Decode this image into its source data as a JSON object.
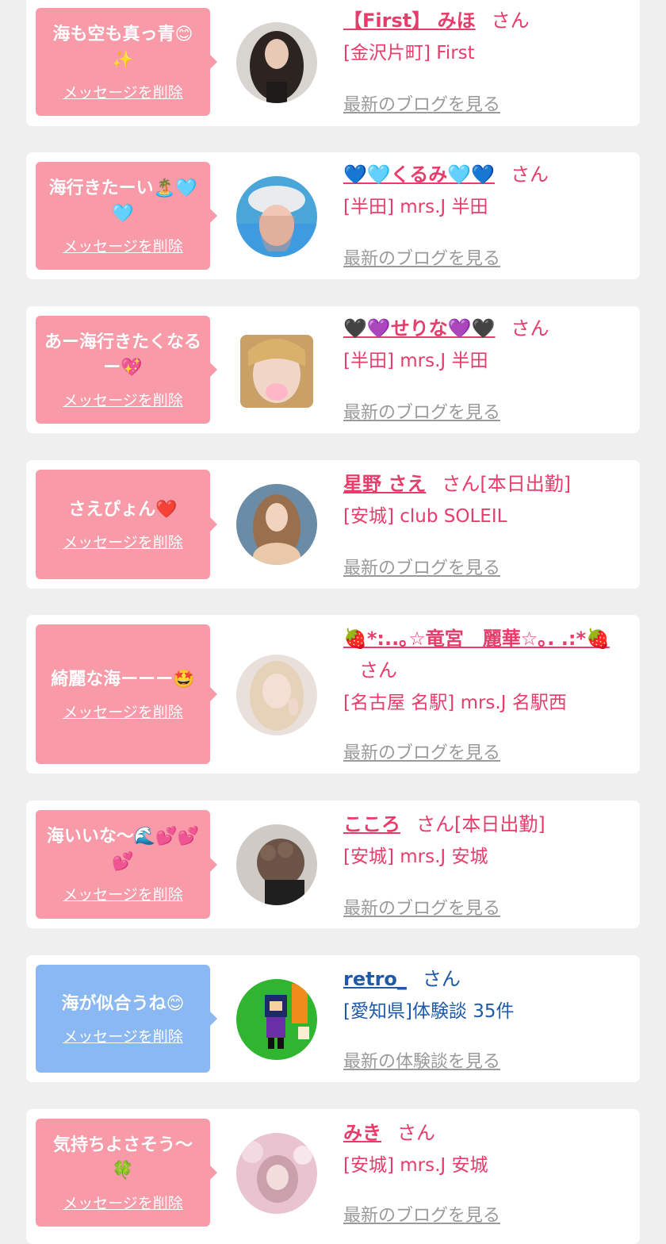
{
  "accent_pink": "#e83c6a",
  "accent_blue": "#1f5aa6",
  "bubble_pink": "#f89aa8",
  "bubble_blue": "#8ab8f3",
  "delete_label": "メッセージを削除",
  "items": [
    {
      "message": "海も空も真っ青😊✨",
      "name": "【First】 みほ",
      "san": "さん",
      "shop": "[金沢片町] First",
      "blog": "最新のブログを見る",
      "type": "pink",
      "avatar_icon": "woman-curly-hair-photo"
    },
    {
      "message": "海行きたーい🏝️🩵🩵",
      "name": "💙🩵くるみ🩵💙",
      "san": "さん",
      "shop": "[半田] mrs.J 半田",
      "blog": "最新のブログを見る",
      "type": "pink",
      "avatar_icon": "woman-cap-photo"
    },
    {
      "message": "あー海行きたくなるー💖",
      "name": "🖤💜せりな💜🖤",
      "san": "さん",
      "shop": "[半田] mrs.J 半田",
      "blog": "最新のブログを見る",
      "type": "pink",
      "avatar_icon": "woman-blonde-photo"
    },
    {
      "message": "さえぴょん❤️",
      "name": "星野 さえ",
      "san": "さん[本日出勤]",
      "shop": "[安城] club SOLEIL",
      "blog": "最新のブログを見る",
      "type": "pink",
      "avatar_icon": "woman-long-hair-photo"
    },
    {
      "message": "綺麗な海ーーー🤩",
      "name": "🍓*:..｡☆竜宮　麗華☆｡. .:*🍓",
      "san": "さん",
      "shop": "[名古屋 名駅] mrs.J 名駅西",
      "blog": "最新のブログを見る",
      "type": "pink",
      "avatar_icon": "woman-peace-sign-photo"
    },
    {
      "message": "海いいな〜🌊💕💕💕",
      "name": "こころ",
      "san": "さん[本日出勤]",
      "shop": "[安城] mrs.J 安城",
      "blog": "最新のブログを見る",
      "type": "pink",
      "avatar_icon": "hair-updo-photo"
    },
    {
      "message": "海が似合うね😊",
      "name": "retro_",
      "san": "さん",
      "shop": "[愛知県]体験談 35件",
      "blog": "最新の体験談を見る",
      "type": "blue",
      "avatar_icon": "pixel-character-avatar"
    },
    {
      "message": "気持ちよさそう〜🍀",
      "name": "みき",
      "san": "さん",
      "shop": "[安城] mrs.J 安城",
      "blog": "最新のブログを見る",
      "type": "pink",
      "avatar_icon": "woman-flowers-photo"
    }
  ]
}
